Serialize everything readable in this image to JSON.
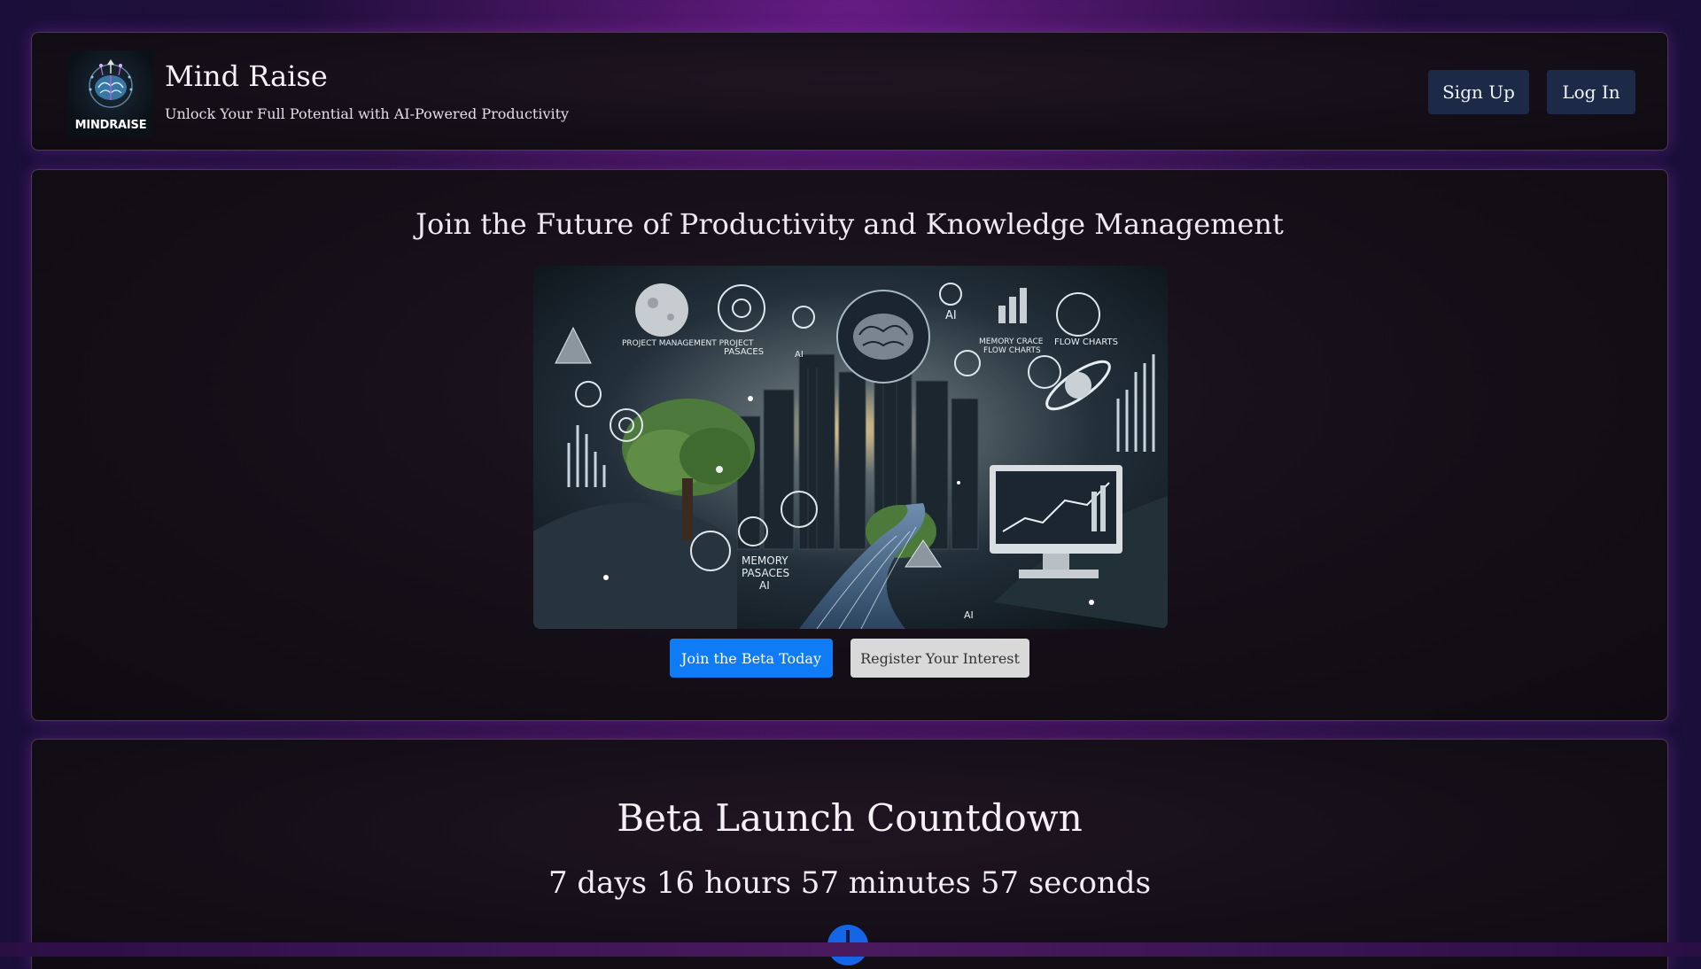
{
  "header": {
    "logo_text": "MINDRAISE",
    "title": "Mind Raise",
    "tagline": "Unlock Your Full Potential with AI-Powered Productivity",
    "nav": {
      "signup_label": "Sign Up",
      "login_label": "Log In"
    }
  },
  "hero": {
    "title": "Join the Future of Productivity and Knowledge Management",
    "image_labels": {
      "project_management": "PROJECT MANAGEMENT PROJECT",
      "pasaces": "PASACES",
      "ai_top": "AI",
      "ai_small": "AI",
      "memory_crace": "MEMORY CRACE",
      "flow_charts_small": "FLOW CHARTS",
      "flow_charts": "FLOW CHARTS",
      "memory": "MEMORY",
      "pasaces_bottom": "PASACES",
      "ai_bottom": "AI",
      "ai_corner": "AI"
    },
    "join_label": "Join the Beta Today",
    "register_label": "Register Your Interest"
  },
  "countdown": {
    "title": "Beta Launch Countdown",
    "remaining": "7 days 16 hours 57 minutes 57 seconds"
  },
  "colors": {
    "accent_blue": "#0f7bf5",
    "nav_button": "#1c2a48",
    "background_purple": "#2a0d3c"
  },
  "icons": [
    "brain-logo-icon",
    "arrow-fab-icon"
  ]
}
